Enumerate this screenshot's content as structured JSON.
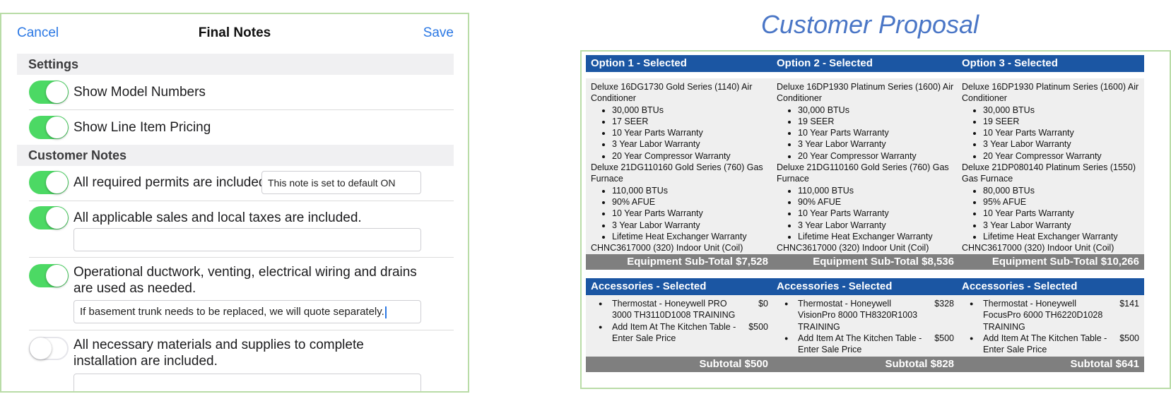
{
  "notes": {
    "nav": {
      "cancel": "Cancel",
      "title": "Final Notes",
      "save": "Save"
    },
    "settings_header": "Settings",
    "settings": [
      {
        "label": "Show Model Numbers",
        "on": true
      },
      {
        "label": "Show Line Item Pricing",
        "on": true
      }
    ],
    "customer_notes_header": "Customer Notes",
    "customer_notes": [
      {
        "label": "All required permits are included.",
        "on": true,
        "note": "This note is set to default ON"
      },
      {
        "label": "All applicable sales and local taxes are included.",
        "on": true,
        "note": ""
      },
      {
        "label": "Operational ductwork, venting, electrical wiring and drains are used as needed.",
        "on": true,
        "note": "If basement trunk needs to be replaced, we will quote separately."
      },
      {
        "label": "All necessary materials and supplies to complete installation are included.",
        "on": false,
        "note": ""
      }
    ]
  },
  "proposal": {
    "title": "Customer Proposal",
    "options": [
      {
        "header": "Option 1 - Selected",
        "equipment": [
          {
            "name": "Deluxe 16DG1730 Gold Series (1140) Air Conditioner",
            "specs": [
              "30,000 BTUs",
              "17 SEER",
              "10 Year Parts Warranty",
              "3 Year Labor Warranty",
              "20 Year Compressor Warranty"
            ]
          },
          {
            "name": "Deluxe 21DG110160 Gold Series (760) Gas Furnace",
            "specs": [
              "110,000 BTUs",
              "90% AFUE",
              "10 Year Parts Warranty",
              "3 Year Labor Warranty",
              "Lifetime Heat Exchanger Warranty"
            ]
          },
          {
            "name": "CHNC3617000 (320) Indoor Unit (Coil)",
            "specs": []
          }
        ],
        "equipment_subtotal": "Equipment Sub-Total $7,528",
        "accessories_header": "Accessories - Selected",
        "accessories": [
          {
            "name": "Thermostat - Honeywell PRO 3000 TH3110D1008 TRAINING",
            "price": "$0"
          },
          {
            "name": "Add Item At The Kitchen Table - Enter Sale Price",
            "price": "$500"
          }
        ],
        "accessories_subtotal": "Subtotal $500"
      },
      {
        "header": "Option 2 - Selected",
        "equipment": [
          {
            "name": "Deluxe 16DP1930 Platinum Series (1600) Air Conditioner",
            "specs": [
              "30,000 BTUs",
              "19 SEER",
              "10 Year Parts Warranty",
              "3 Year Labor Warranty",
              "20 Year Compressor Warranty"
            ]
          },
          {
            "name": "Deluxe 21DG110160 Gold Series (760) Gas Furnace",
            "specs": [
              "110,000 BTUs",
              "90% AFUE",
              "10 Year Parts Warranty",
              "3 Year Labor Warranty",
              "Lifetime Heat Exchanger Warranty"
            ]
          },
          {
            "name": "CHNC3617000 (320) Indoor Unit (Coil)",
            "specs": []
          }
        ],
        "equipment_subtotal": "Equipment Sub-Total $8,536",
        "accessories_header": "Accessories - Selected",
        "accessories": [
          {
            "name": "Thermostat - Honeywell VisionPro 8000 TH8320R1003 TRAINING",
            "price": "$328"
          },
          {
            "name": "Add Item At The Kitchen Table - Enter Sale Price",
            "price": "$500"
          }
        ],
        "accessories_subtotal": "Subtotal $828"
      },
      {
        "header": "Option 3 - Selected",
        "equipment": [
          {
            "name": "Deluxe 16DP1930 Platinum Series (1600) Air Conditioner",
            "specs": [
              "30,000 BTUs",
              "19 SEER",
              "10 Year Parts Warranty",
              "3 Year Labor Warranty",
              "20 Year Compressor Warranty"
            ]
          },
          {
            "name": "Deluxe 21DP080140 Platinum Series (1550) Gas Furnace",
            "specs": [
              "80,000 BTUs",
              "95% AFUE",
              "10 Year Parts Warranty",
              "3 Year Labor Warranty",
              "Lifetime Heat Exchanger Warranty"
            ]
          },
          {
            "name": "CHNC3617000 (320) Indoor Unit (Coil)",
            "specs": []
          }
        ],
        "equipment_subtotal": "Equipment Sub-Total $10,266",
        "accessories_header": "Accessories - Selected",
        "accessories": [
          {
            "name": "Thermostat - Honeywell FocusPro 6000 TH6220D1028 TRAINING",
            "price": "$141"
          },
          {
            "name": "Add Item At The Kitchen Table - Enter Sale Price",
            "price": "$500"
          }
        ],
        "accessories_subtotal": "Subtotal $641"
      }
    ]
  }
}
